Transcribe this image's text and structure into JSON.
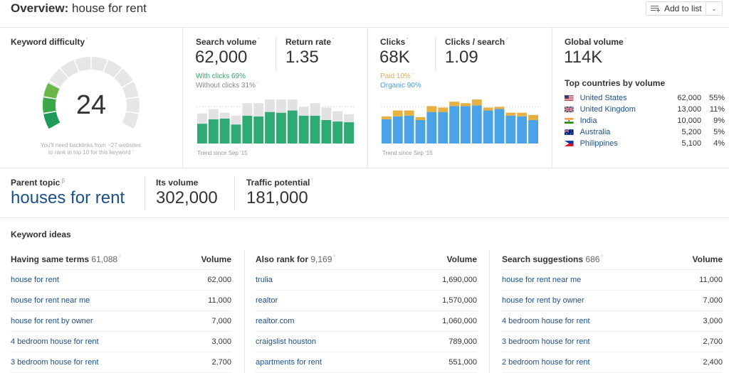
{
  "header": {
    "title_prefix": "Overview:",
    "keyword": "house for rent",
    "add_to_list_label": "Add to list"
  },
  "keyword_difficulty": {
    "label": "Keyword difficulty",
    "value": "24",
    "score": 24,
    "max": 100,
    "note_line1": "You'll need backlinks from ~27 websites",
    "note_line2": "to rank in top 10 for this keyword"
  },
  "search_volume": {
    "label": "Search volume",
    "value": "62,000",
    "return_rate_label": "Return rate",
    "return_rate": "1.35",
    "with_clicks": "With clicks 69%",
    "without_clicks": "Without clicks 31%",
    "trend_label": "Trend since Sep '15",
    "colors": {
      "with_clicks": "#2eaa73",
      "without_clicks": "#e2e2e4"
    }
  },
  "clicks": {
    "label": "Clicks",
    "value": "68K",
    "per_search_label": "Clicks / search",
    "per_search": "1.09",
    "paid": "Paid 10%",
    "organic": "Organic 90%",
    "trend_label": "Trend since Sep '15",
    "colors": {
      "paid": "#e8b040",
      "organic": "#4aa3e6"
    }
  },
  "global_volume": {
    "label": "Global volume",
    "value": "114K",
    "top_countries_label": "Top countries by volume",
    "countries": [
      {
        "name": "United States",
        "volume": "62,000",
        "pct": "55%",
        "flag": "us-flag"
      },
      {
        "name": "United Kingdom",
        "volume": "13,000",
        "pct": "11%",
        "flag": "uk-flag"
      },
      {
        "name": "India",
        "volume": "10,000",
        "pct": "9%",
        "flag": "india-flag"
      },
      {
        "name": "Australia",
        "volume": "5,200",
        "pct": "5%",
        "flag": "australia-flag"
      },
      {
        "name": "Philippines",
        "volume": "5,100",
        "pct": "4%",
        "flag": "philippines-flag"
      }
    ]
  },
  "parent_topic": {
    "label": "Parent topic",
    "value": "houses for rent",
    "its_volume_label": "Its volume",
    "its_volume": "302,000",
    "traffic_potential_label": "Traffic potential",
    "traffic_potential": "181,000"
  },
  "keyword_ideas": {
    "title": "Keyword ideas",
    "columns": [
      {
        "title": "Having same terms",
        "count": "61,088",
        "volume_label": "Volume",
        "rows": [
          {
            "keyword": "house for rent",
            "volume": "62,000"
          },
          {
            "keyword": "house for rent near me",
            "volume": "11,000"
          },
          {
            "keyword": "house for rent by owner",
            "volume": "7,000"
          },
          {
            "keyword": "4 bedroom house for rent",
            "volume": "3,000"
          },
          {
            "keyword": "3 bedroom house for rent",
            "volume": "2,700"
          }
        ]
      },
      {
        "title": "Also rank for",
        "count": "9,169",
        "volume_label": "Volume",
        "rows": [
          {
            "keyword": "trulia",
            "volume": "1,690,000"
          },
          {
            "keyword": "realtor",
            "volume": "1,570,000"
          },
          {
            "keyword": "realtor.com",
            "volume": "1,060,000"
          },
          {
            "keyword": "craigslist houston",
            "volume": "789,000"
          },
          {
            "keyword": "apartments for rent",
            "volume": "551,000"
          }
        ]
      },
      {
        "title": "Search suggestions",
        "count": "686",
        "volume_label": "Volume",
        "rows": [
          {
            "keyword": "house for rent near me",
            "volume": "11,000"
          },
          {
            "keyword": "house for rent by owner",
            "volume": "7,000"
          },
          {
            "keyword": "4 bedroom house for rent",
            "volume": "3,000"
          },
          {
            "keyword": "3 bedroom house for rent",
            "volume": "2,700"
          },
          {
            "keyword": "2 bedroom house for rent",
            "volume": "2,400"
          }
        ]
      }
    ]
  },
  "chart_data": [
    {
      "type": "bar",
      "title": "Search volume trend",
      "xlabel": "Trend since Sep '15",
      "ylabel": "",
      "stacked": true,
      "categories": [
        "1",
        "2",
        "3",
        "4",
        "5",
        "6",
        "7",
        "8",
        "9",
        "10",
        "11",
        "12",
        "13",
        "14"
      ],
      "series": [
        {
          "name": "With clicks",
          "values": [
            27,
            33,
            34,
            26,
            38,
            37,
            43,
            42,
            45,
            38,
            38,
            32,
            30,
            29
          ]
        },
        {
          "name": "Without clicks",
          "values": [
            14,
            14,
            8,
            12,
            17,
            18,
            17,
            18,
            15,
            12,
            17,
            17,
            14,
            11
          ]
        }
      ],
      "ylim": [
        0,
        62
      ]
    },
    {
      "type": "bar",
      "title": "Clicks trend",
      "xlabel": "Trend since Sep '15",
      "ylabel": "",
      "stacked": true,
      "categories": [
        "1",
        "2",
        "3",
        "4",
        "5",
        "6",
        "7",
        "8",
        "9",
        "10",
        "11",
        "12",
        "13",
        "14"
      ],
      "series": [
        {
          "name": "Organic",
          "values": [
            33,
            37,
            38,
            32,
            43,
            43,
            51,
            51,
            52,
            45,
            47,
            38,
            37,
            32
          ]
        },
        {
          "name": "Paid",
          "values": [
            4,
            8,
            7,
            4,
            8,
            6,
            6,
            4,
            8,
            4,
            3,
            4,
            5,
            7
          ]
        }
      ],
      "ylim": [
        0,
        62
      ]
    }
  ]
}
